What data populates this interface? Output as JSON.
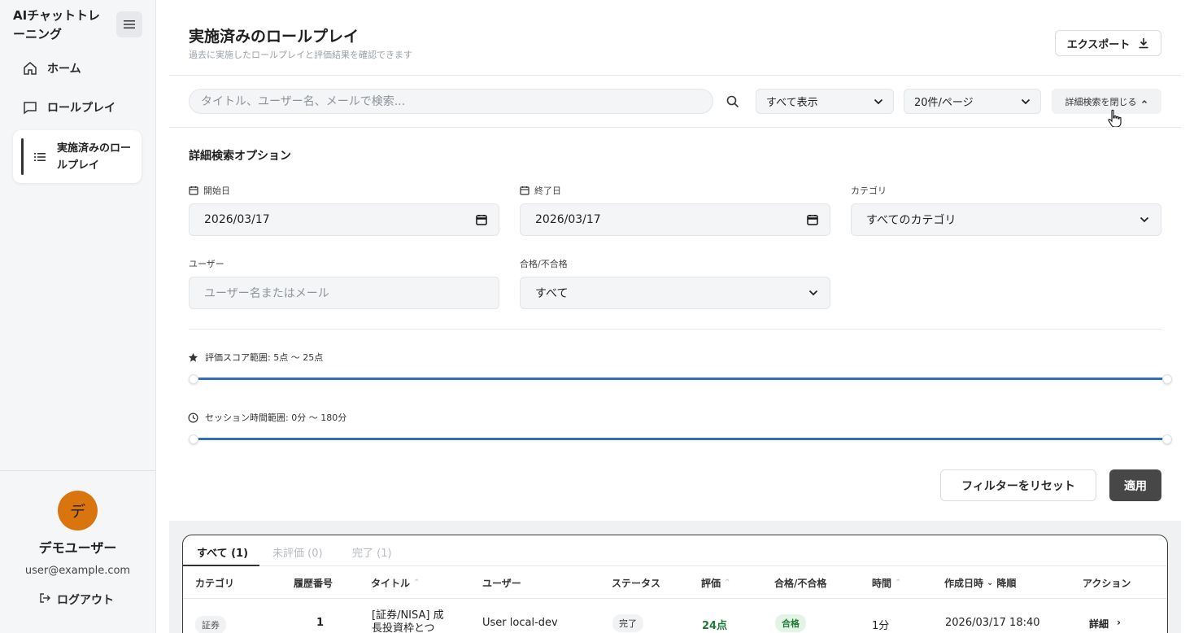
{
  "app": {
    "title": "AIチャットトレーニング"
  },
  "sidebar": {
    "items": [
      {
        "label": "ホーム",
        "icon": "home-icon"
      },
      {
        "label": "ロールプレイ",
        "icon": "chat-icon"
      },
      {
        "label": "実施済みのロールプレイ",
        "icon": "list-icon",
        "active": true
      }
    ],
    "user": {
      "avatar_initial": "デ",
      "name": "デモユーザー",
      "email": "user@example.com",
      "avatar_color": "#d9740f"
    },
    "logout_label": "ログアウト"
  },
  "header": {
    "title": "実施済みのロールプレイ",
    "subtitle": "過去に実施したロールプレイと評価結果を確認できます",
    "export_label": "エクスポート"
  },
  "toolbar": {
    "search_placeholder": "タイトル、ユーザー名、メールで検索...",
    "filter_value": "すべて表示",
    "per_page_value": "20件/ページ",
    "advanced_toggle_label": "詳細検索を閉じる"
  },
  "advanced": {
    "title": "詳細検索オプション",
    "start_date_label": "開始日",
    "start_date_value": "2026/03/17",
    "end_date_label": "終了日",
    "end_date_value": "2026/03/17",
    "category_label": "カテゴリ",
    "category_value": "すべてのカテゴリ",
    "user_label": "ユーザー",
    "user_placeholder": "ユーザー名またはメール",
    "pass_label": "合格/不合格",
    "pass_value": "すべて",
    "score_range_label": "評価スコア範囲: 5点 〜 25点",
    "score_range": [
      5,
      25
    ],
    "time_range_label": "セッション時間範囲: 0分 〜 180分",
    "time_range": [
      0,
      180
    ],
    "reset_label": "フィルターをリセット",
    "apply_label": "適用",
    "accent_color": "#2f6fc0"
  },
  "table": {
    "tabs": [
      {
        "label": "すべて (1)",
        "active": true
      },
      {
        "label": "未評価 (0)",
        "active": false
      },
      {
        "label": "完了 (1)",
        "active": false
      }
    ],
    "columns": [
      "カテゴリ",
      "履歴番号",
      "タイトル",
      "ユーザー",
      "ステータス",
      "評価",
      "合格/不合格",
      "時間",
      "作成日時",
      "アクション"
    ],
    "sort_label": "降順",
    "rows": [
      {
        "category": "証券",
        "number": "1",
        "title": "[証券/NISA] 成長投資枠とつ",
        "user": "User local-dev",
        "status": "完了",
        "score": "24点",
        "result": "合格",
        "time": "1分",
        "created": "2026/03/17 18:40",
        "action": "詳細"
      }
    ]
  }
}
